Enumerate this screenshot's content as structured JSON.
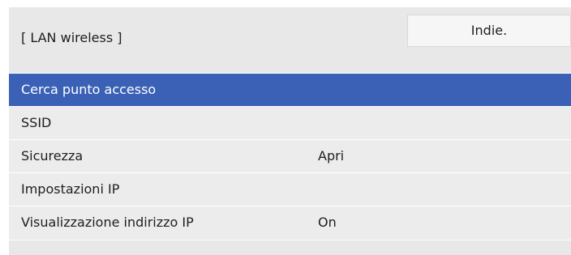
{
  "header": {
    "title": "[ LAN wireless ]",
    "back_label": "Indie."
  },
  "menu": {
    "items": [
      {
        "label": "Cerca punto accesso",
        "value": "",
        "selected": true
      },
      {
        "label": "SSID",
        "value": ""
      },
      {
        "label": "Sicurezza",
        "value": "Apri"
      },
      {
        "label": "Impostazioni IP",
        "value": ""
      },
      {
        "label": "Visualizzazione indirizzo IP",
        "value": "On"
      }
    ]
  },
  "colors": {
    "panel_background": "#eaeaea",
    "selection": "#3b61b6",
    "text": "#1e1e1e"
  }
}
